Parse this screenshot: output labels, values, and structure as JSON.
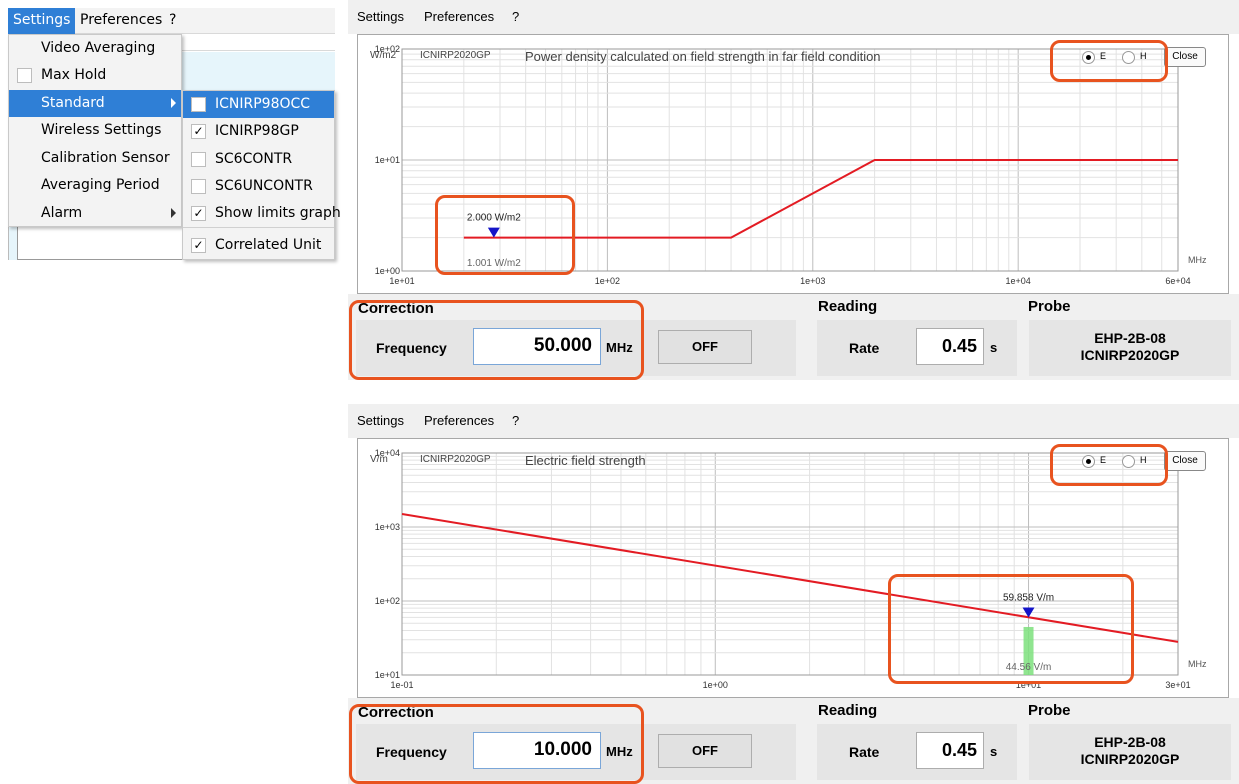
{
  "menu": {
    "bar": {
      "settings": "Settings",
      "preferences": "Preferences",
      "help": "?"
    },
    "items": [
      {
        "label": "Video Averaging"
      },
      {
        "label": "Max Hold",
        "checked": false
      },
      {
        "label": "Standard",
        "selected": true
      },
      {
        "label": "Wireless Settings"
      },
      {
        "label": "Calibration Sensor"
      },
      {
        "label": "Averaging Period"
      },
      {
        "label": "Alarm"
      }
    ],
    "submenu": [
      {
        "label": "ICNIRP98OCC",
        "checked": false
      },
      {
        "label": "ICNIRP98GP",
        "checked": true
      },
      {
        "label": "SC6CONTR",
        "checked": false
      },
      {
        "label": "SC6UNCONTR",
        "checked": false
      },
      {
        "label": "Show limits graph",
        "checked": true
      },
      {
        "label": "Correlated Unit",
        "checked": true
      }
    ],
    "check_mark": "✓"
  },
  "colors": {
    "accent": "#2f7fd6",
    "limit_line": "#e31b23",
    "highlight": "#e8531f",
    "marker": "#1414c8",
    "bar": "#7de07d"
  },
  "panels": [
    {
      "menubar": {
        "settings": "Settings",
        "preferences": "Preferences",
        "help": "?"
      },
      "plot": {
        "unit": "W/m2",
        "standard": "ICNIRP2020GP",
        "title": "Power density calculated on field strength in far field condition",
        "x_unit": "MHz",
        "radio_e": "E",
        "radio_h": "H",
        "selected": "E",
        "close": "Close"
      },
      "chart_data": {
        "type": "line",
        "x_scale": "log",
        "y_scale": "log",
        "xlim": [
          10,
          60000
        ],
        "ylim": [
          1,
          100
        ],
        "x_ticks": [
          "1e+01",
          "1e+02",
          "1e+03",
          "1e+04",
          "6e+04"
        ],
        "y_ticks": [
          "1e+02",
          "1e+01",
          "1e+00"
        ],
        "series": [
          {
            "points": [
              [
                20,
                2
              ],
              [
                400,
                2
              ],
              [
                2000,
                10
              ],
              [
                60000,
                10
              ]
            ]
          }
        ],
        "marker": {
          "x": 28,
          "value_label": "2.000 W/m2",
          "value": 2.0
        },
        "reading_label": "1.001 W/m2",
        "grid": true
      },
      "correction": {
        "title": "Correction",
        "frequency_label": "Frequency",
        "frequency_value": "50.000",
        "unit": "MHz",
        "button": "OFF"
      },
      "reading": {
        "title": "Reading",
        "rate_label": "Rate",
        "rate_value": "0.45",
        "rate_unit": "s"
      },
      "probe": {
        "title": "Probe",
        "model": "EHP-2B-08",
        "standard": "ICNIRP2020GP"
      }
    },
    {
      "menubar": {
        "settings": "Settings",
        "preferences": "Preferences",
        "help": "?"
      },
      "plot": {
        "unit": "V/m",
        "standard": "ICNIRP2020GP",
        "title": "Electric field strength",
        "x_unit": "MHz",
        "radio_e": "E",
        "radio_h": "H",
        "selected": "E",
        "close": "Close"
      },
      "chart_data": {
        "type": "line",
        "x_scale": "log",
        "y_scale": "log",
        "xlim": [
          0.1,
          30
        ],
        "ylim": [
          10,
          10000
        ],
        "x_ticks": [
          "1e-01",
          "1e+00",
          "1e+01",
          "3e+01"
        ],
        "y_ticks": [
          "1e+04",
          "1e+03",
          "1e+02",
          "1e+01"
        ],
        "series": [
          {
            "points": [
              [
                0.1,
                1500
              ],
              [
                30,
                28
              ]
            ]
          }
        ],
        "marker": {
          "x": 10,
          "value_label": "59.858 V/m",
          "value": 59.858
        },
        "bar": {
          "x": 10,
          "value": 44.56
        },
        "reading_label": "44.56 V/m",
        "grid": true
      },
      "correction": {
        "title": "Correction",
        "frequency_label": "Frequency",
        "frequency_value": "10.000",
        "unit": "MHz",
        "button": "OFF"
      },
      "reading": {
        "title": "Reading",
        "rate_label": "Rate",
        "rate_value": "0.45",
        "rate_unit": "s"
      },
      "probe": {
        "title": "Probe",
        "model": "EHP-2B-08",
        "standard": "ICNIRP2020GP"
      }
    }
  ]
}
